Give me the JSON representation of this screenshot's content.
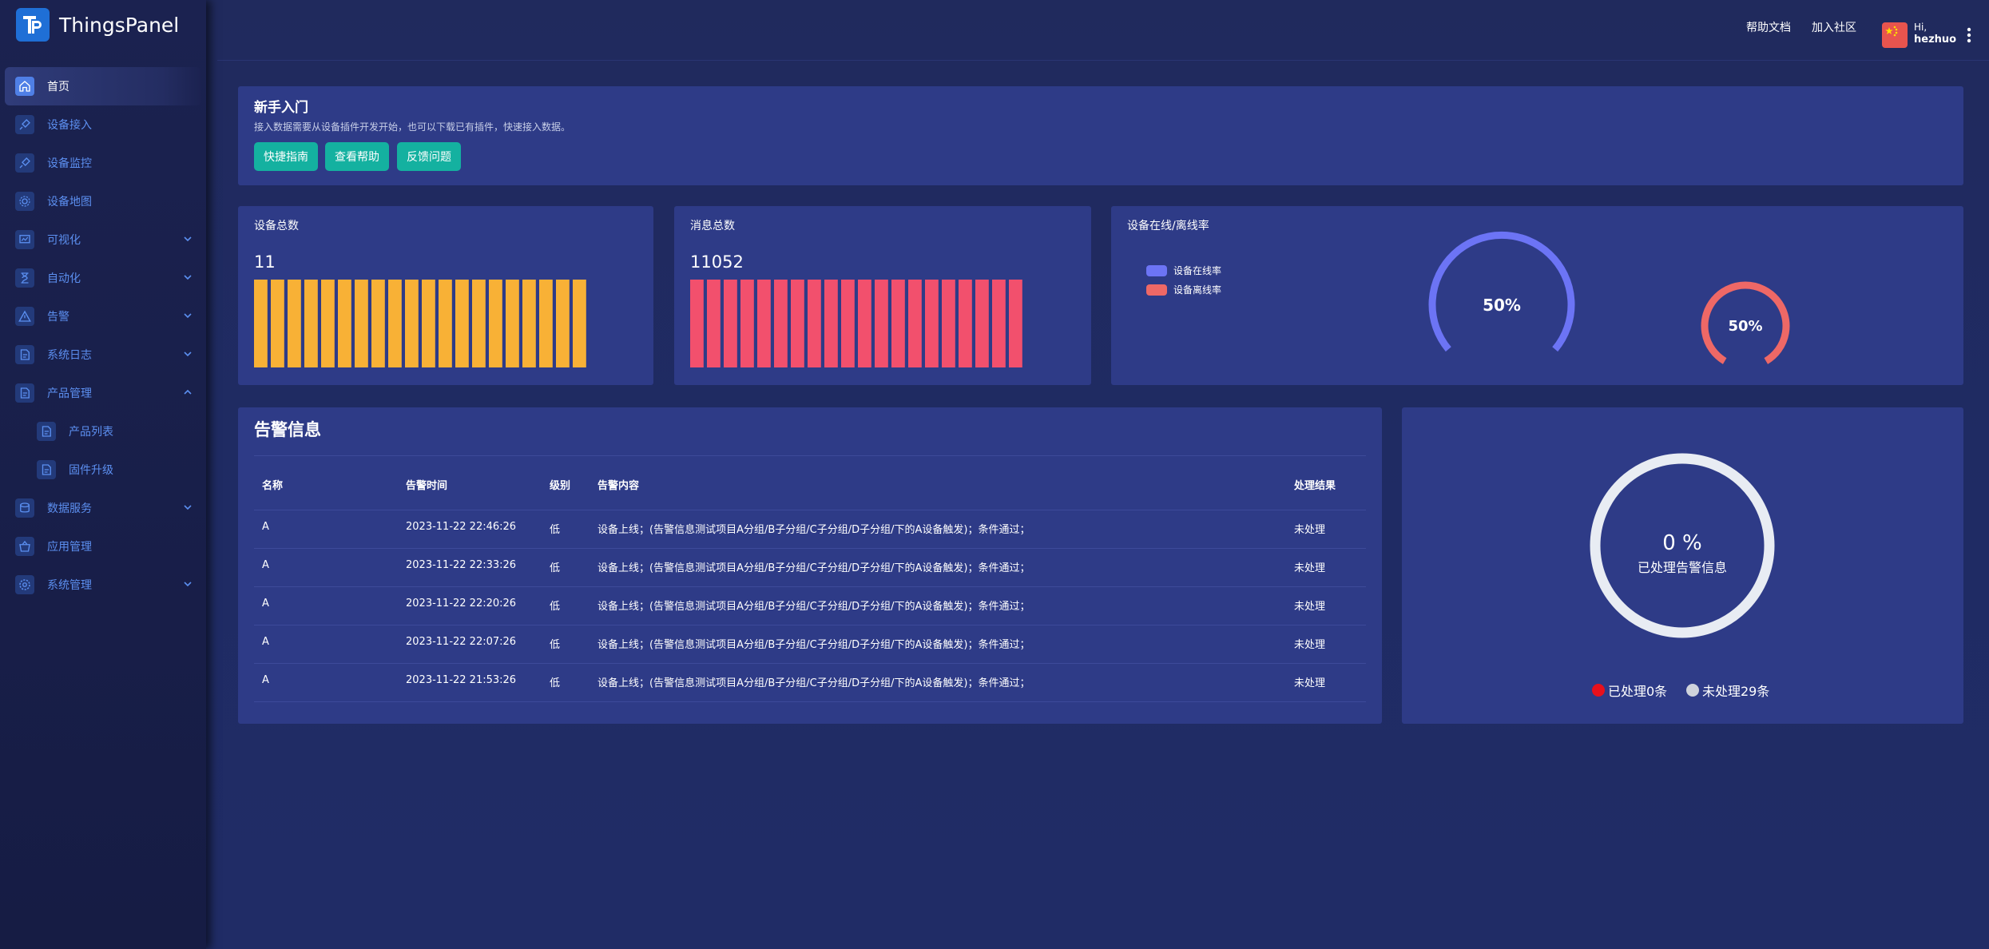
{
  "app": {
    "name": "ThingsPanel"
  },
  "sidebar": {
    "items": [
      {
        "label": "首页",
        "icon": "home-icon",
        "active": true
      },
      {
        "label": "设备接入",
        "icon": "plug-icon"
      },
      {
        "label": "设备监控",
        "icon": "monitor-icon"
      },
      {
        "label": "设备地图",
        "icon": "map-icon"
      },
      {
        "label": "可视化",
        "icon": "visualization-icon",
        "chevron": "down"
      },
      {
        "label": "自动化",
        "icon": "automation-icon",
        "chevron": "down"
      },
      {
        "label": "告警",
        "icon": "alert-icon",
        "chevron": "down"
      },
      {
        "label": "系统日志",
        "icon": "log-icon",
        "chevron": "down"
      },
      {
        "label": "产品管理",
        "icon": "product-icon",
        "chevron": "up"
      },
      {
        "label": "产品列表",
        "icon": "product-list-icon",
        "sub": true
      },
      {
        "label": "固件升级",
        "icon": "firmware-icon",
        "sub": true
      },
      {
        "label": "数据服务",
        "icon": "data-service-icon",
        "chevron": "down"
      },
      {
        "label": "应用管理",
        "icon": "app-store-icon"
      },
      {
        "label": "系统管理",
        "icon": "settings-icon",
        "chevron": "down"
      }
    ]
  },
  "header": {
    "links": [
      "帮助文档",
      "加入社区"
    ],
    "greeting": "Hi,",
    "username": "hezhuo",
    "avatar_icon": "china-flag-icon"
  },
  "guide": {
    "title": "新手入门",
    "description": "接入数据需要从设备插件开发开始，也可以下载已有插件，快速接入数据。",
    "buttons": [
      "快捷指南",
      "查看帮助",
      "反馈问题"
    ]
  },
  "device_total": {
    "title": "设备总数",
    "value": "11",
    "color": "#f8b136",
    "bar_count": 20
  },
  "message_total": {
    "title": "消息总数",
    "value": "11052",
    "color": "#f2506d",
    "bar_count": 20
  },
  "online_rate": {
    "title": "设备在线/离线率",
    "legend": [
      {
        "label": "设备在线率",
        "color": "#6c74f5"
      },
      {
        "label": "设备离线率",
        "color": "#ee6866"
      }
    ],
    "online_percent": "50%",
    "offline_percent": "50%",
    "online_value": 0.5,
    "offline_value": 0.5
  },
  "alerts": {
    "title": "告警信息",
    "columns": [
      "名称",
      "告警时间",
      "级别",
      "告警内容",
      "处理结果"
    ],
    "rows": [
      [
        "A",
        "2023-11-22 22:46:26",
        "低",
        "设备上线；(告警信息测试项目A分组/B子分组/C子分组/D子分组/下的A设备触发)；条件通过；",
        "未处理"
      ],
      [
        "A",
        "2023-11-22 22:33:26",
        "低",
        "设备上线；(告警信息测试项目A分组/B子分组/C子分组/D子分组/下的A设备触发)；条件通过；",
        "未处理"
      ],
      [
        "A",
        "2023-11-22 22:20:26",
        "低",
        "设备上线；(告警信息测试项目A分组/B子分组/C子分组/D子分组/下的A设备触发)；条件通过；",
        "未处理"
      ],
      [
        "A",
        "2023-11-22 22:07:26",
        "低",
        "设备上线；(告警信息测试项目A分组/B子分组/C子分组/D子分组/下的A设备触发)；条件通过；",
        "未处理"
      ],
      [
        "A",
        "2023-11-22 21:53:26",
        "低",
        "设备上线；(告警信息测试项目A分组/B子分组/C子分组/D子分组/下的A设备触发)；条件通过；",
        "未处理"
      ]
    ]
  },
  "processed": {
    "percent": "0 %",
    "label": "已处理告警信息",
    "legend": [
      {
        "label": "已处理0条",
        "color": "#e8101c"
      },
      {
        "label": "未处理29条",
        "color": "#cfd3dc"
      }
    ]
  }
}
